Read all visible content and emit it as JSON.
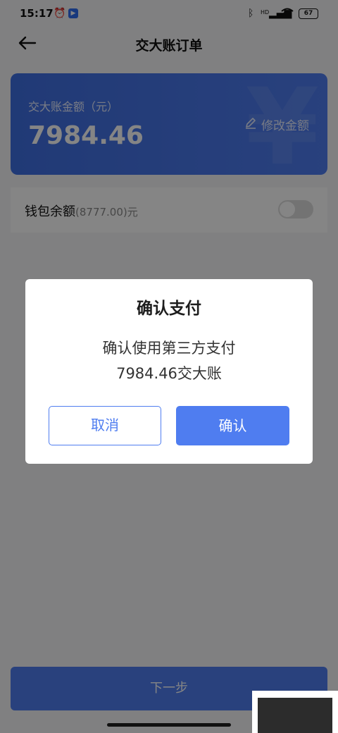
{
  "status_bar": {
    "time": "15:17",
    "battery": "67",
    "signal_label": "HD"
  },
  "nav": {
    "title": "交大账订单",
    "back_icon": "arrow-left-icon"
  },
  "amount_card": {
    "label": "交大账金额（元）",
    "amount": "7984.46",
    "edit_label": "修改金额",
    "bg_symbol": "¥",
    "accent": "#4f7df0"
  },
  "wallet": {
    "label": "钱包余额",
    "balance": "(8777.00)",
    "unit": "元",
    "toggle_on": false
  },
  "next_button": {
    "label": "下一步"
  },
  "dialog": {
    "title": "确认支付",
    "message_line1": "确认使用第三方支付",
    "message_line2": "7984.46交大账",
    "cancel_label": "取消",
    "confirm_label": "确认"
  }
}
